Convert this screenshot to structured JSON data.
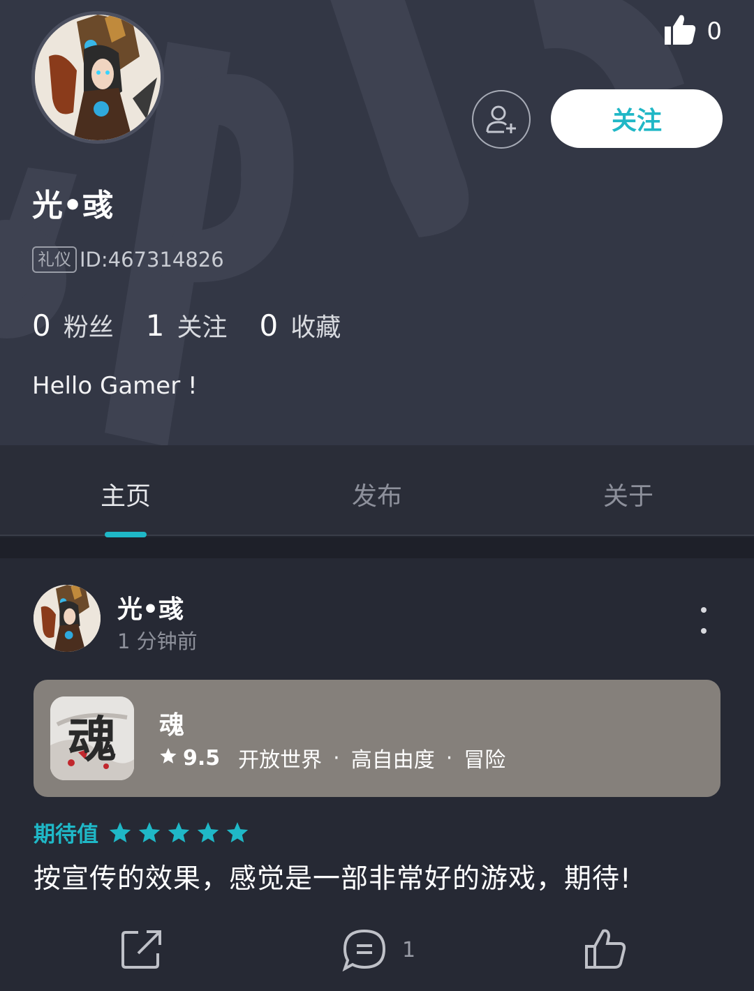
{
  "profile": {
    "like_count": "0",
    "follow_label": "关注",
    "username": "光•彧",
    "badge": "礼仪",
    "user_id": "ID:467314826",
    "stats": [
      {
        "num": "0",
        "label": "粉丝"
      },
      {
        "num": "1",
        "label": "关注"
      },
      {
        "num": "0",
        "label": "收藏"
      }
    ],
    "bio": "Hello Gamer !"
  },
  "tabs": [
    {
      "label": "主页",
      "active": true
    },
    {
      "label": "发布",
      "active": false
    },
    {
      "label": "关于",
      "active": false
    }
  ],
  "post": {
    "author": "光•彧",
    "time": "1 分钟前",
    "game": {
      "name": "魂",
      "rating": "9.5",
      "tags": [
        "开放世界",
        "高自由度",
        "冒险"
      ],
      "icon_glyph": "魂"
    },
    "expect_label": "期待值",
    "expect_stars": 5,
    "review": "按宣传的效果，感觉是一部非常好的游戏，期待!",
    "comment_count": "1"
  },
  "colors": {
    "accent": "#1fb8c7",
    "header_bg": "#333745",
    "body_bg": "#22252f",
    "game_card_bg": "#85807b"
  }
}
